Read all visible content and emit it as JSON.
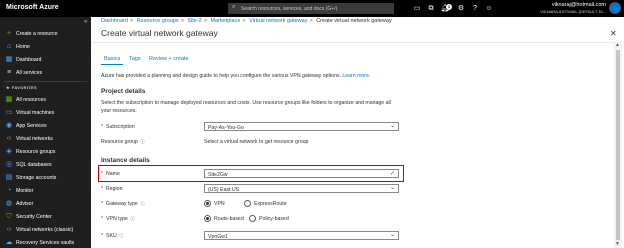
{
  "topbar": {
    "brand": "Microsoft Azure",
    "search_placeholder": "Search resources, services, and docs (G+/)",
    "notification_count": "1",
    "user_email": "viknaraj@hotmail.com",
    "user_directory": "VIKNARAJHOTMAIL (DEFAULT DI..."
  },
  "sidebar": {
    "items": [
      {
        "label": "Create a resource",
        "icon": "plus-icon"
      },
      {
        "label": "Home",
        "icon": "home-icon"
      },
      {
        "label": "Dashboard",
        "icon": "dashboard-icon"
      },
      {
        "label": "All services",
        "icon": "list-icon"
      },
      {
        "label": "All resources",
        "icon": "grid-icon"
      },
      {
        "label": "Virtual machines",
        "icon": "monitor-icon"
      },
      {
        "label": "App Services",
        "icon": "globe-icon"
      },
      {
        "label": "Virtual networks",
        "icon": "network-icon"
      },
      {
        "label": "Resource groups",
        "icon": "cube-icon"
      },
      {
        "label": "SQL databases",
        "icon": "database-icon"
      },
      {
        "label": "Storage accounts",
        "icon": "storage-icon"
      },
      {
        "label": "Monitor",
        "icon": "gauge-icon"
      },
      {
        "label": "Advisor",
        "icon": "advisor-icon"
      },
      {
        "label": "Security Center",
        "icon": "shield-icon"
      },
      {
        "label": "Virtual networks (classic)",
        "icon": "network-icon"
      },
      {
        "label": "Recovery Services vaults",
        "icon": "cloud-icon"
      }
    ],
    "favorites_label": "FAVORITES"
  },
  "breadcrumb": {
    "items": [
      "Dashboard",
      "Resource groups",
      "Site-2",
      "Marketplace",
      "Virtual network gateway"
    ],
    "current": "Create virtual network gateway"
  },
  "page": {
    "title": "Create virtual network gateway",
    "tabs": [
      "Basics",
      "Tags",
      "Review + create"
    ],
    "intro": "Azure has provided a planning and design guide to help you configure the various VPN gateway options.",
    "learn_more": "Learn more."
  },
  "project": {
    "heading": "Project details",
    "description": "Select the subscription to manage deployed resources and costs. Use resource groups like folders to organize and manage all your resources.",
    "subscription_label": "Subscription",
    "subscription_value": "Pay-As-You-Go",
    "resource_group_label": "Resource group",
    "resource_group_value": "Select a virtual network to get resource group"
  },
  "instance": {
    "heading": "Instance details",
    "name_label": "Name",
    "name_value": "Site2Gw",
    "region_label": "Region",
    "region_value": "(US) East US",
    "gateway_type_label": "Gateway type",
    "gateway_type_options": [
      "VPN",
      "ExpressRoute"
    ],
    "gateway_type_selected": "VPN",
    "vpn_type_label": "VPN type",
    "vpn_type_options": [
      "Route-based",
      "Policy-based"
    ],
    "vpn_type_selected": "Route-based",
    "sku_label": "SKU",
    "sku_value": "VpnGw1"
  },
  "colors": {
    "accent": "#0078d4",
    "sidebar_bg": "#1f1f1f",
    "topbar_bg": "#000000",
    "highlight": "#c00000"
  }
}
